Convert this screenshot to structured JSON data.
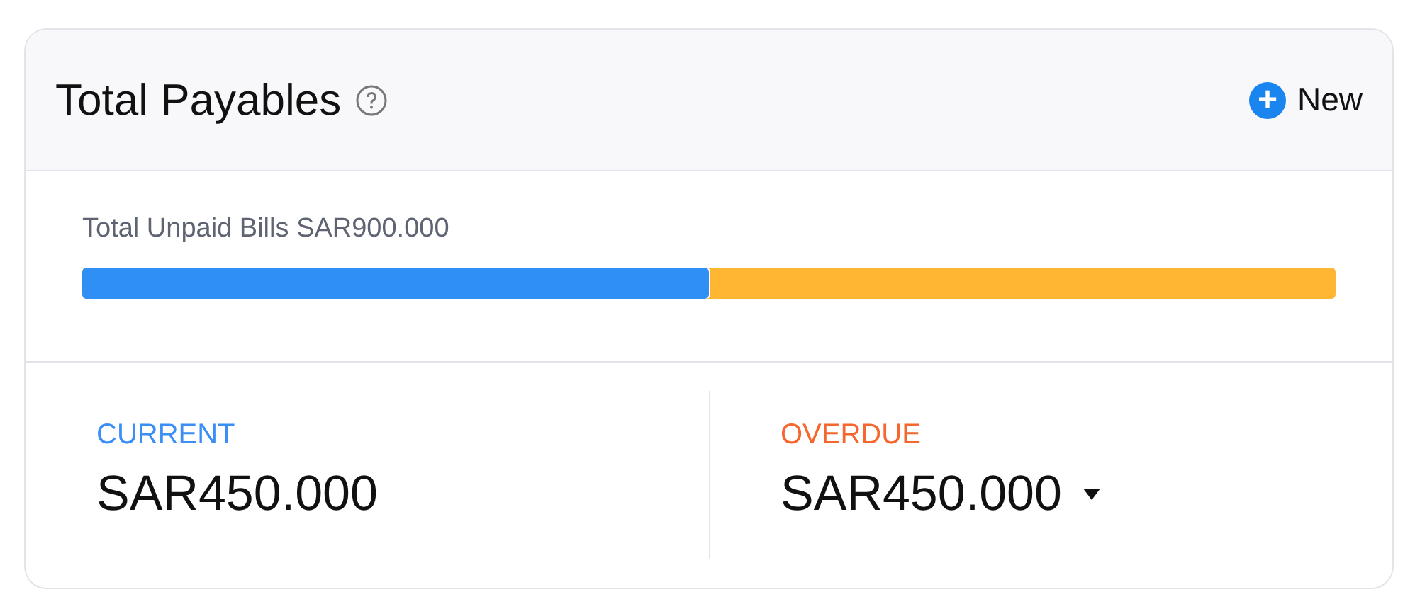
{
  "card": {
    "title": "Total Payables",
    "new_button": {
      "icon": "+",
      "label": "New"
    }
  },
  "summary": {
    "label": "Total Unpaid Bills SAR900.000",
    "bar": {
      "level": 0.5
    }
  },
  "buckets": [
    {
      "label": "CURRENT",
      "amount": "SAR450.000",
      "color": "#3c8ef7",
      "dropdown": false
    },
    {
      "label": "OVERDUE",
      "amount": "SAR450.000",
      "color": "#f5672e",
      "dropdown": true
    }
  ]
}
